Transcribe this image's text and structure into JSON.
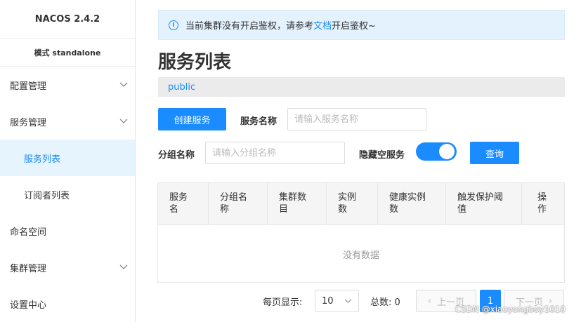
{
  "sidebar": {
    "logo": "NACOS 2.4.2",
    "mode": "模式 standalone",
    "items": [
      {
        "label": "配置管理",
        "has_chevron": true
      },
      {
        "label": "服务管理",
        "has_chevron": true
      },
      {
        "label": "服务列表",
        "active": true
      },
      {
        "label": "订阅者列表"
      },
      {
        "label": "命名空间"
      },
      {
        "label": "集群管理",
        "has_chevron": true
      },
      {
        "label": "设置中心"
      }
    ]
  },
  "notice": {
    "text_before": "当前集群没有开启鉴权，请参考",
    "link": "文档",
    "text_after": "开启鉴权~"
  },
  "page_title": "服务列表",
  "namespace": "public",
  "form": {
    "create_button": "创建服务",
    "service_name_label": "服务名称",
    "service_name_placeholder": "请输入服务名称",
    "group_name_label": "分组名称",
    "group_name_placeholder": "请输入分组名称",
    "hide_empty_label": "隐藏空服务",
    "hide_empty_on": true,
    "query_button": "查询"
  },
  "table": {
    "headers": [
      "服务\n名",
      "分组名\n称",
      "集群数\n目",
      "实例\n数",
      "健康实例\n数",
      "触发保护阈\n值",
      "操\n作"
    ],
    "empty_text": "没有数据"
  },
  "pagination": {
    "page_size_label": "每页显示:",
    "page_size": "10",
    "total_label": "总数: 0",
    "prev": "上一页",
    "current": "1",
    "next": "下一页"
  },
  "watermark": "CSDN @xiaoyongboy1010",
  "colors": {
    "accent": "#1a8cff",
    "active_bg": "#e6f4fd"
  }
}
